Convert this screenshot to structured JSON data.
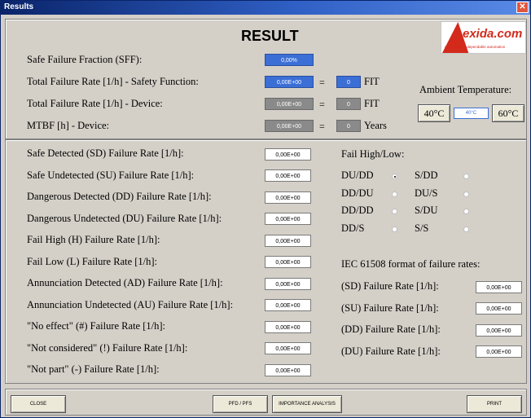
{
  "window": {
    "title": "Results",
    "close_glyph": "✕"
  },
  "heading": "RESULT",
  "logo": {
    "text": "exida.com",
    "tagline": "excellence in dependable automation"
  },
  "top": {
    "sff_label": "Safe Failure Fraction (SFF):",
    "sff_value": "0,00%",
    "tfr_sf_label": "Total Failure Rate [1/h] - Safety Function:",
    "tfr_sf_value": "0,00E+00",
    "tfr_sf_fit": "0",
    "tfr_dev_label": "Total Failure Rate [1/h] - Device:",
    "tfr_dev_value": "0,00E+00",
    "tfr_dev_fit": "0",
    "mtbf_label": "MTBF [h] - Device:",
    "mtbf_value": "0,00E+00",
    "mtbf_years": "0",
    "equals": "=",
    "fit_unit": "FIT",
    "years_unit": "Years"
  },
  "temperature": {
    "label": "Ambient Temperature:",
    "btn_40": "40°C",
    "current": "40°C",
    "btn_60": "60°C"
  },
  "rates": [
    {
      "label": "Safe Detected (SD) Failure Rate [1/h]:",
      "value": "0,00E+00"
    },
    {
      "label": "Safe Undetected (SU) Failure Rate [1/h]:",
      "value": "0,00E+00"
    },
    {
      "label": "Dangerous Detected (DD) Failure Rate [1/h]:",
      "value": "0,00E+00"
    },
    {
      "label": "Dangerous Undetected (DU) Failure Rate [1/h]:",
      "value": "0,00E+00"
    },
    {
      "label": "Fail High (H) Failure Rate [1/h]:",
      "value": "0,00E+00"
    },
    {
      "label": "Fail Low (L) Failure Rate [1/h]:",
      "value": "0,00E+00"
    },
    {
      "label": "Annunciation Detected (AD) Failure Rate [1/h]:",
      "value": "0,00E+00"
    },
    {
      "label": "Annunciation Undetected (AU) Failure Rate [1/h]:",
      "value": "0,00E+00"
    },
    {
      "label": "\"No effect\" (#) Failure Rate [1/h]:",
      "value": "0,00E+00"
    },
    {
      "label": "\"Not considered\" (!) Failure Rate [1/h]:",
      "value": "0,00E+00"
    },
    {
      "label": "\"Not part\" (-) Failure Rate [1/h]:",
      "value": "0,00E+00"
    }
  ],
  "fail_high_low": {
    "title": "Fail High/Low:",
    "options": [
      {
        "label": "DU/DD",
        "selected": true
      },
      {
        "label": "S/DD",
        "selected": false
      },
      {
        "label": "DD/DU",
        "selected": false
      },
      {
        "label": "DU/S",
        "selected": false
      },
      {
        "label": "DD/DD",
        "selected": false
      },
      {
        "label": "S/DU",
        "selected": false
      },
      {
        "label": "DD/S",
        "selected": false
      },
      {
        "label": "S/S",
        "selected": false
      }
    ]
  },
  "iec": {
    "title": "IEC 61508 format of failure rates:",
    "rows": [
      {
        "label": "(SD) Failure Rate [1/h]:",
        "value": "0,00E+00"
      },
      {
        "label": "(SU) Failure Rate [1/h]:",
        "value": "0,00E+00"
      },
      {
        "label": "(DD) Failure Rate [1/h]:",
        "value": "0,00E+00"
      },
      {
        "label": "(DU) Failure Rate [1/h]:",
        "value": "0,00E+00"
      }
    ]
  },
  "buttons": {
    "close": "CLOSE",
    "pfd_pfs": "PFD / PFS",
    "importance": "IMPORTANCE ANALYSIS",
    "print": "PRINT"
  },
  "colors": {
    "accent_blue": "#3b6fd6",
    "readonly_gray": "#8a8a8a",
    "brand_red": "#d32a1c"
  }
}
